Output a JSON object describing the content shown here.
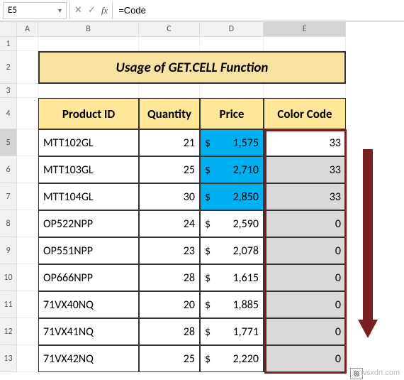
{
  "namebox": "E5",
  "formula": "=Code",
  "columns": [
    "A",
    "B",
    "C",
    "D",
    "E"
  ],
  "rows": [
    "1",
    "2",
    "3",
    "4",
    "5",
    "6",
    "7",
    "8",
    "9",
    "10",
    "11",
    "12",
    "13"
  ],
  "title": "Usage of GET.CELL Function",
  "headers": {
    "product": "Product ID",
    "qty": "Quantity",
    "price": "Price",
    "code": "Color Code"
  },
  "data": [
    {
      "pid": "MTT102GL",
      "qty": "21",
      "cur": "$",
      "price": "1,575",
      "code": "33",
      "blue": true,
      "sel": true
    },
    {
      "pid": "MTT103GL",
      "qty": "25",
      "cur": "$",
      "price": "2,710",
      "code": "33",
      "blue": true
    },
    {
      "pid": "MTT104GL",
      "qty": "30",
      "cur": "$",
      "price": "2,850",
      "code": "33",
      "blue": true
    },
    {
      "pid": "OP522NPP",
      "qty": "24",
      "cur": "$",
      "price": "2,590",
      "code": "0"
    },
    {
      "pid": "OP551NPP",
      "qty": "23",
      "cur": "$",
      "price": "2,078",
      "code": "0"
    },
    {
      "pid": "OP666NPP",
      "qty": "28",
      "cur": "$",
      "price": "1,615",
      "code": "0"
    },
    {
      "pid": "71VX40NQ",
      "qty": "20",
      "cur": "$",
      "price": "1,885",
      "code": "0"
    },
    {
      "pid": "71VX41NQ",
      "qty": "28",
      "cur": "$",
      "price": "1,771",
      "code": "0"
    },
    {
      "pid": "71VX42NQ",
      "qty": "25",
      "cur": "$",
      "price": "2,220",
      "code": "0"
    }
  ],
  "watermark": "wsxdn.com",
  "chart_data": {
    "type": "table",
    "title": "Usage of GET.CELL Function",
    "columns": [
      "Product ID",
      "Quantity",
      "Price",
      "Color Code"
    ],
    "rows": [
      [
        "MTT102GL",
        21,
        1575,
        33
      ],
      [
        "MTT103GL",
        25,
        2710,
        33
      ],
      [
        "MTT104GL",
        30,
        2850,
        33
      ],
      [
        "OP522NPP",
        24,
        2590,
        0
      ],
      [
        "OP551NPP",
        23,
        2078,
        0
      ],
      [
        "OP666NPP",
        28,
        1615,
        0
      ],
      [
        "71VX40NQ",
        20,
        1885,
        0
      ],
      [
        "71VX41NQ",
        28,
        1771,
        0
      ],
      [
        "71VX42NQ",
        25,
        2220,
        0
      ]
    ]
  }
}
